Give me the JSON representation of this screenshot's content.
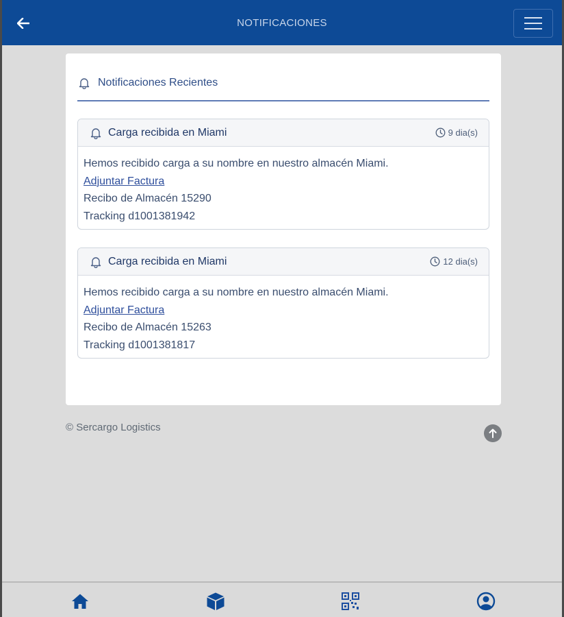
{
  "header": {
    "title": "NOTIFICACIONES",
    "back_icon": "arrow-left-icon",
    "menu_icon": "hamburger-icon"
  },
  "panel": {
    "title": "Notificaciones Recientes",
    "icon": "bell-icon"
  },
  "notifications": [
    {
      "title": "Carga recibida en Miami",
      "time": "9 dia(s)",
      "message": "Hemos recibido carga a su nombre en nuestro almacén Miami.",
      "link": "Adjuntar Factura",
      "receipt": "Recibo de Almacén 15290",
      "tracking": "Tracking d1001381942"
    },
    {
      "title": "Carga recibida en Miami",
      "time": "12 dia(s)",
      "message": "Hemos recibido carga a su nombre en nuestro almacén Miami.",
      "link": "Adjuntar Factura",
      "receipt": "Recibo de Almacén 15263",
      "tracking": "Tracking d1001381817"
    }
  ],
  "footer": {
    "copyright": "© Sercargo Logistics"
  },
  "bottom_nav": [
    {
      "icon": "home-icon"
    },
    {
      "icon": "package-icon"
    },
    {
      "icon": "qr-code-icon"
    },
    {
      "icon": "user-circle-icon"
    }
  ],
  "colors": {
    "primary": "#0d4a96",
    "background": "#dcdcdc"
  }
}
